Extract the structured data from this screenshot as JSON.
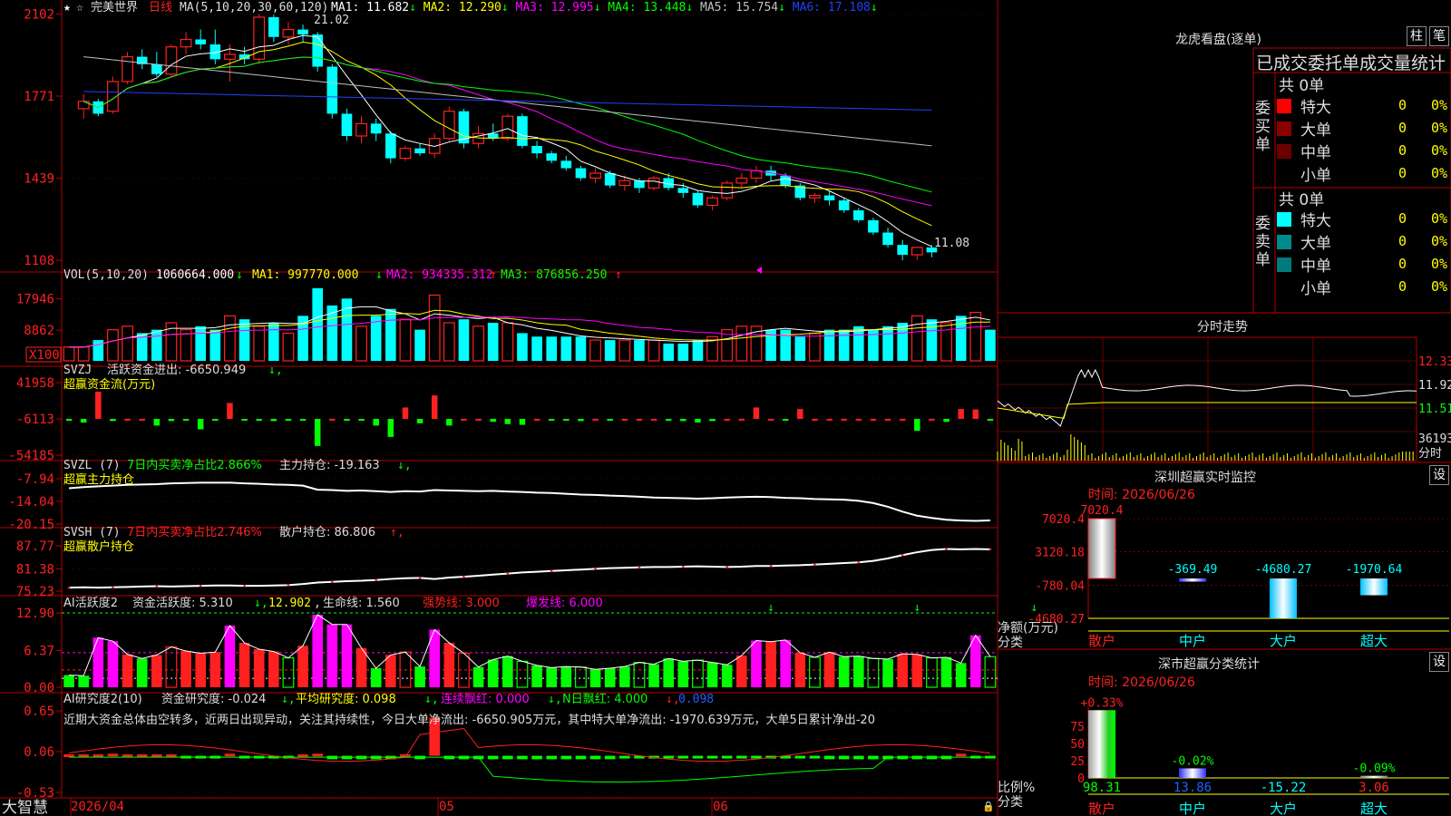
{
  "app": {
    "name": "大智慧",
    "stock_name": "完美世界",
    "period": "日线"
  },
  "colors": {
    "up": "#ff2020",
    "down": "#00ffff",
    "grid": "#b40000",
    "bg": "#000000"
  },
  "price_panel": {
    "ma_params": "MA(5,10,20,30,60,120)",
    "ma": [
      {
        "label": "MA1: 11.682",
        "arrow": "↓",
        "color": "#ffffff"
      },
      {
        "label": "MA2: 12.290",
        "arrow": "↓",
        "color": "#ffff00"
      },
      {
        "label": "MA3: 12.995",
        "arrow": "↓",
        "color": "#ff00ff"
      },
      {
        "label": "MA4: 13.448",
        "arrow": "↓",
        "color": "#00ff00"
      },
      {
        "label": "MA5: 15.754",
        "arrow": "↓",
        "color": "#c0c0c0"
      },
      {
        "label": "MA6: 17.108",
        "arrow": "↓",
        "color": "#2040ff"
      }
    ],
    "y_ticks": [
      "2102",
      "1771",
      "1439",
      "1108"
    ],
    "high_label": "21.02",
    "low_label": "11.08"
  },
  "vol_panel": {
    "title": "VOL(5,10,20)",
    "value": "1060664.000",
    "arrow": "↓",
    "ma1": "MA1: 997770.000",
    "ma2": "MA2: 934335.312",
    "ma3": "MA3: 876856.250",
    "y_ticks": [
      "17946",
      "8862"
    ],
    "unit": "X100"
  },
  "svzj_panel": {
    "title": "SVZJ",
    "item": "活跃资金进出: -6650.949",
    "subtitle": "超赢资金流(万元)",
    "y_ticks": [
      "41958",
      "-6113",
      "-54185"
    ]
  },
  "svzl_panel": {
    "title": "SVZL (7)",
    "ratio": "7日内买卖净占比2.866%",
    "item": "主力持仓: -19.163",
    "subtitle": "超赢主力持仓",
    "y_ticks": [
      "-7.94",
      "-14.04",
      "-20.15"
    ]
  },
  "svsh_panel": {
    "title": "SVSH (7)",
    "ratio": "7日内买卖净占比2.746%",
    "item": "散户持仓: 86.806",
    "subtitle": "超赢散户持仓",
    "y_ticks": [
      "87.77",
      "81.38",
      "75.23"
    ]
  },
  "ai_active_panel": {
    "title": "AI活跃度2",
    "i1": "资金活跃度: 5.310",
    "i2": "12.902",
    "i3": "生命线: 1.560",
    "i4": "强势线: 3.000",
    "i5": "爆发线: 6.000",
    "y_ticks": [
      "12.90",
      "6.37",
      "0.00"
    ]
  },
  "ai_research_panel": {
    "title": "AI研究度2(10)",
    "i1": "资金研究度: -0.024",
    "i2": "平均研究度: 0.098",
    "i3": "连续飘红: 0.000",
    "i4": "N日飘红: 4.000",
    "i5": "0.098",
    "comment": "近期大资金总体由空转多，近两日出现异动，关注其持续性，今日大单净流出: -6650.905万元，其中特大单净流出: -1970.639万元，大单5日累计净出-20",
    "y_ticks": [
      "0.65",
      "0.06",
      "-0.53"
    ]
  },
  "x_axis": {
    "labels": [
      "2026/04",
      "05",
      "06"
    ]
  },
  "right": {
    "lh_title": "龙虎看盘(逐单)",
    "btn_bar": "柱",
    "btn_pen": "笔",
    "stats_header": "已成交委托单成交量统计",
    "buy_label": "委买单",
    "buy_total": "共 0单",
    "sell_label": "委卖单",
    "sell_total": "共 0单",
    "buy_rows": [
      {
        "label": "特大",
        "count": "0",
        "pct": "0%"
      },
      {
        "label": "大单",
        "count": "0",
        "pct": "0%"
      },
      {
        "label": "中单",
        "count": "0",
        "pct": "0%"
      },
      {
        "label": "小单",
        "count": "0",
        "pct": "0%"
      }
    ],
    "sell_rows": [
      {
        "label": "特大",
        "count": "0",
        "pct": "0%"
      },
      {
        "label": "大单",
        "count": "0",
        "pct": "0%"
      },
      {
        "label": "中单",
        "count": "0",
        "pct": "0%"
      },
      {
        "label": "小单",
        "count": "0",
        "pct": "0%"
      }
    ],
    "intraday_title": "分时走势",
    "intraday_ticks": [
      "12.33",
      "11.92",
      "11.51"
    ],
    "intraday_vol": "36193",
    "intraday_unit": "分时",
    "sz_monitor_title": "深圳超赢实时监控",
    "sz_set": "设",
    "sz_date": "时间: 2026/06/26",
    "sz_y_ticks": [
      "7020.4",
      "3120.18",
      "-780.04",
      "-4680.27"
    ],
    "sz_bars": [
      {
        "cat": "散户",
        "value": 7020.4,
        "label": "7020.4"
      },
      {
        "cat": "中户",
        "value": -369.49,
        "label": "-369.49"
      },
      {
        "cat": "大户",
        "value": -4680.27,
        "label": "-4680.27"
      },
      {
        "cat": "超大",
        "value": -1970.64,
        "label": "-1970.64"
      }
    ],
    "sz_unit": "净额(万元)",
    "sz_cat_label": "分类",
    "ss_title": "深市超赢分类统计",
    "ss_set": "设",
    "ss_date": "时间: 2026/06/26",
    "ss_y_ticks": [
      "75",
      "50",
      "25",
      "0"
    ],
    "ss_bars": [
      {
        "cat": "散户",
        "pct": 98.31,
        "top": "+0.33%",
        "bottom": "98.31"
      },
      {
        "cat": "中户",
        "pct": 13.86,
        "top": "-0.02%",
        "bottom": "13.86"
      },
      {
        "cat": "大户",
        "pct": -15.22,
        "top": "",
        "bottom": "-15.22"
      },
      {
        "cat": "超大",
        "pct": 3.06,
        "top": "-0.09%",
        "bottom": "3.06"
      }
    ],
    "ss_unit": "比例%",
    "ss_cat_label": "分类"
  },
  "chart_data": [
    {
      "type": "candlestick",
      "title": "完美世界 日线",
      "ohlc": [
        [
          17.2,
          17.8,
          16.8,
          17.5
        ],
        [
          17.5,
          17.6,
          16.9,
          17.0
        ],
        [
          17.1,
          18.5,
          17.0,
          18.3
        ],
        [
          18.3,
          19.5,
          18.2,
          19.3
        ],
        [
          19.3,
          19.6,
          18.8,
          19.0
        ],
        [
          19.0,
          19.5,
          18.5,
          18.6
        ],
        [
          18.6,
          19.8,
          18.5,
          19.7
        ],
        [
          19.7,
          20.3,
          19.4,
          20.0
        ],
        [
          20.0,
          20.4,
          19.6,
          19.8
        ],
        [
          19.8,
          20.4,
          19.0,
          19.2
        ],
        [
          19.2,
          19.8,
          18.3,
          19.4
        ],
        [
          19.4,
          19.7,
          19.0,
          19.2
        ],
        [
          19.2,
          21.02,
          19.0,
          20.9
        ],
        [
          20.9,
          21.0,
          19.9,
          20.1
        ],
        [
          20.1,
          20.7,
          19.8,
          20.4
        ],
        [
          20.4,
          20.6,
          19.9,
          20.2
        ],
        [
          20.2,
          20.3,
          18.7,
          18.9
        ],
        [
          18.9,
          19.0,
          16.8,
          17.0
        ],
        [
          17.0,
          17.2,
          15.9,
          16.1
        ],
        [
          16.1,
          16.9,
          15.8,
          16.6
        ],
        [
          16.6,
          16.8,
          15.9,
          16.2
        ],
        [
          16.2,
          16.3,
          15.0,
          15.2
        ],
        [
          15.2,
          15.7,
          15.1,
          15.6
        ],
        [
          15.6,
          15.8,
          15.3,
          15.4
        ],
        [
          15.4,
          16.2,
          15.2,
          16.0
        ],
        [
          16.0,
          17.3,
          15.9,
          17.1
        ],
        [
          17.1,
          17.2,
          15.6,
          15.8
        ],
        [
          15.8,
          16.5,
          15.6,
          16.2
        ],
        [
          16.2,
          16.6,
          15.9,
          16.0
        ],
        [
          16.0,
          17.0,
          15.9,
          16.9
        ],
        [
          16.9,
          17.0,
          15.6,
          15.7
        ],
        [
          15.7,
          15.9,
          15.2,
          15.4
        ],
        [
          15.4,
          15.5,
          15.0,
          15.1
        ],
        [
          15.1,
          15.3,
          14.7,
          14.8
        ],
        [
          14.8,
          14.9,
          14.3,
          14.4
        ],
        [
          14.4,
          14.8,
          14.2,
          14.6
        ],
        [
          14.6,
          14.7,
          14.0,
          14.1
        ],
        [
          14.1,
          14.5,
          13.9,
          14.3
        ],
        [
          14.3,
          14.4,
          13.8,
          14.0
        ],
        [
          14.0,
          14.5,
          13.9,
          14.4
        ],
        [
          14.4,
          14.6,
          13.9,
          14.0
        ],
        [
          14.0,
          14.2,
          13.6,
          13.8
        ],
        [
          13.8,
          13.9,
          13.2,
          13.3
        ],
        [
          13.3,
          13.7,
          13.1,
          13.6
        ],
        [
          13.6,
          14.3,
          13.5,
          14.2
        ],
        [
          14.2,
          14.6,
          14.0,
          14.4
        ],
        [
          14.4,
          14.9,
          14.2,
          14.7
        ],
        [
          14.7,
          14.9,
          14.3,
          14.5
        ],
        [
          14.5,
          14.6,
          14.0,
          14.1
        ],
        [
          14.1,
          14.2,
          13.5,
          13.6
        ],
        [
          13.6,
          13.8,
          13.4,
          13.7
        ],
        [
          13.7,
          13.9,
          13.3,
          13.5
        ],
        [
          13.5,
          13.6,
          13.0,
          13.1
        ],
        [
          13.1,
          13.2,
          12.6,
          12.7
        ],
        [
          12.7,
          12.8,
          12.1,
          12.2
        ],
        [
          12.2,
          12.4,
          11.6,
          11.7
        ],
        [
          11.7,
          11.9,
          11.08,
          11.3
        ],
        [
          11.3,
          11.5,
          11.1,
          11.6
        ],
        [
          11.6,
          11.7,
          11.2,
          11.4
        ]
      ],
      "y_range": [
        10.9,
        21.3
      ]
    },
    {
      "type": "bar",
      "title": "VOL",
      "values": [
        4,
        4,
        6,
        9,
        10,
        8,
        9,
        11,
        9,
        10,
        9,
        13,
        12,
        10,
        11,
        8,
        13,
        21,
        16,
        18,
        10,
        13,
        15,
        12,
        9,
        19,
        11,
        12,
        10,
        11,
        11,
        8,
        7,
        7,
        7,
        7,
        6,
        6,
        6,
        6,
        6,
        5,
        5,
        6,
        7,
        9,
        10,
        10,
        9,
        9,
        7,
        8,
        9,
        9,
        10,
        9,
        10,
        11,
        13,
        12,
        11,
        13,
        14,
        9
      ]
    },
    {
      "type": "bar",
      "title": "SVZJ",
      "values": [
        -8000,
        -11000,
        30000,
        -9000,
        -6000,
        -6000,
        -15000,
        -9000,
        -8000,
        -20000,
        -7000,
        15000,
        -7000,
        -8000,
        -9000,
        -7000,
        -8000,
        -42000,
        -6000,
        -8000,
        -7000,
        -15000,
        -30000,
        9000,
        -12000,
        25000,
        -15000,
        -6000,
        -6000,
        -10000,
        -13000,
        -14000,
        -6000,
        -8000,
        -7000,
        -9000,
        -6000,
        -7000,
        -6000,
        -6000,
        -6000,
        -7000,
        -9000,
        -11000,
        -9000,
        -6000,
        -6000,
        9000,
        -6000,
        -7000,
        7000,
        -6000,
        -6000,
        -6000,
        -6000,
        -6000,
        -6000,
        -6000,
        -22000,
        -6000,
        -10000,
        7000,
        6500,
        -6650
      ]
    },
    {
      "type": "line",
      "title": "SVZL",
      "values": [
        -10.5,
        -10.2,
        -10.0,
        -9.8,
        -9.6,
        -9.5,
        -9.4,
        -9.2,
        -9.1,
        -9.0,
        -9.0,
        -9.0,
        -9.2,
        -9.3,
        -9.5,
        -9.6,
        -9.8,
        -10.9,
        -11.0,
        -11.2,
        -11.1,
        -11.3,
        -11.5,
        -11.3,
        -11.4,
        -11.0,
        -11.1,
        -11.2,
        -11.3,
        -11.2,
        -11.4,
        -11.5,
        -11.7,
        -11.8,
        -12.0,
        -12.2,
        -12.3,
        -12.5,
        -12.6,
        -12.8,
        -13.0,
        -13.1,
        -13.2,
        -13.3,
        -13.2,
        -13.0,
        -12.9,
        -12.8,
        -12.9,
        -13.1,
        -13.2,
        -13.4,
        -13.5,
        -13.6,
        -13.9,
        -14.5,
        -15.5,
        -16.8,
        -17.9,
        -18.5,
        -19.0,
        -19.2,
        -19.3,
        -19.16
      ]
    },
    {
      "type": "line",
      "title": "SVSH",
      "values": [
        76.2,
        76.3,
        76.2,
        76.3,
        76.4,
        76.5,
        76.6,
        76.5,
        76.6,
        76.7,
        76.8,
        76.8,
        76.7,
        76.7,
        76.8,
        76.9,
        77.2,
        77.6,
        77.8,
        78.0,
        78.1,
        78.3,
        78.6,
        78.8,
        78.9,
        78.6,
        79.0,
        79.2,
        79.5,
        79.8,
        80.1,
        80.4,
        80.6,
        80.8,
        81.0,
        81.2,
        81.4,
        81.6,
        81.7,
        81.8,
        81.9,
        81.9,
        82.0,
        82.1,
        82.0,
        81.9,
        82.0,
        82.2,
        82.2,
        82.3,
        82.4,
        82.6,
        82.8,
        83.0,
        83.2,
        83.6,
        84.3,
        85.2,
        86.0,
        86.6,
        86.9,
        86.8,
        86.9,
        86.81
      ]
    },
    {
      "type": "bar",
      "title": "AI活跃度2",
      "values": [
        2.1,
        2.0,
        8.6,
        8.0,
        5.7,
        5.0,
        5.6,
        7.0,
        6.3,
        5.9,
        6.1,
        10.7,
        7.7,
        6.6,
        6.2,
        5.1,
        7.2,
        12.6,
        10.9,
        10.9,
        6.8,
        3.3,
        5.6,
        6.1,
        3.6,
        10.0,
        7.7,
        5.9,
        3.5,
        4.8,
        5.4,
        4.5,
        3.8,
        3.4,
        3.6,
        3.5,
        3.1,
        3.3,
        3.6,
        4.3,
        4.0,
        5.0,
        4.5,
        4.7,
        4.3,
        3.9,
        5.5,
        8.1,
        7.9,
        8.2,
        6.0,
        5.2,
        6.1,
        5.3,
        5.4,
        5.0,
        4.9,
        5.8,
        5.7,
        5.1,
        5.2,
        4.2,
        9.0,
        5.31
      ]
    },
    {
      "type": "bar",
      "title": "AI研究度2(10)",
      "values": [
        0.02,
        0.02,
        0.02,
        0.03,
        0.02,
        0.02,
        0.02,
        0.02,
        -0.03,
        -0.03,
        -0.03,
        0.03,
        -0.03,
        -0.03,
        -0.03,
        -0.03,
        0.02,
        0.03,
        -0.05,
        -0.05,
        -0.05,
        -0.05,
        -0.05,
        0.02,
        -0.05,
        0.55,
        -0.05,
        -0.05,
        -0.05,
        -0.05,
        -0.05,
        -0.05,
        -0.05,
        -0.05,
        -0.05,
        -0.05,
        -0.05,
        -0.05,
        -0.03,
        -0.03,
        -0.03,
        -0.03,
        -0.03,
        -0.03,
        -0.03,
        -0.03,
        -0.03,
        -0.03,
        -0.03,
        -0.03,
        -0.03,
        -0.03,
        -0.05,
        -0.05,
        -0.05,
        -0.05,
        -0.05,
        -0.05,
        -0.05,
        -0.05,
        -0.05,
        0.03,
        -0.03,
        -0.024
      ]
    }
  ]
}
